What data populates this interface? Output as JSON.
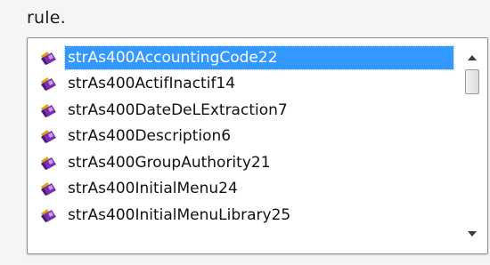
{
  "heading": "rule.",
  "list": {
    "selected_index": 0,
    "item_icon": "class-member-icon",
    "items": [
      "strAs400AccountingCode22",
      "strAs400ActifInactif14",
      "strAs400DateDeLExtraction7",
      "strAs400Description6",
      "strAs400GroupAuthority21",
      "strAs400InitialMenu24",
      "strAs400InitialMenuLibrary25"
    ]
  },
  "scrollbar": {
    "position_fraction": 0.0,
    "up_icon": "arrow-up-icon",
    "down_icon": "arrow-down-icon"
  },
  "colors": {
    "selection": "#3399ff",
    "icon_purple": "#7a2fb0",
    "icon_gold": "#e0a800"
  }
}
